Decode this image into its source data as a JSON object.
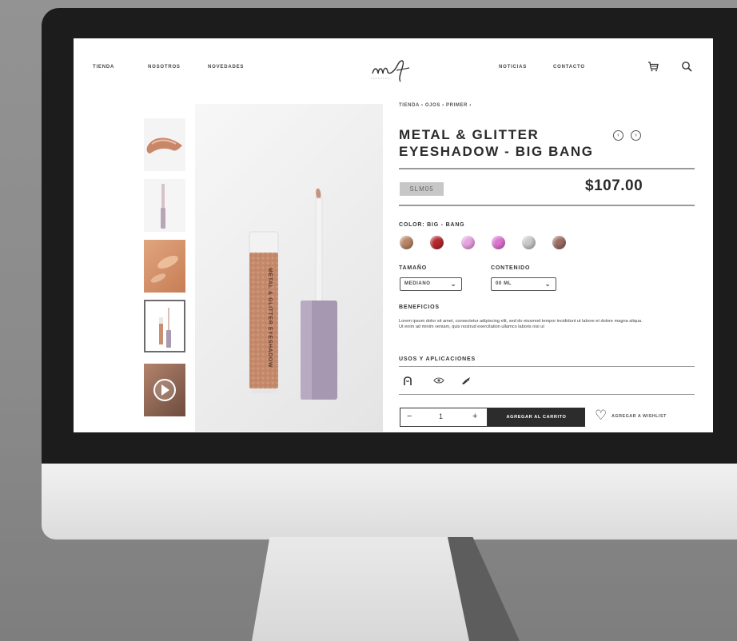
{
  "nav": {
    "left_items": [
      "TIENDA",
      "NOSOTROS",
      "NOVEDADES"
    ],
    "right_items": [
      "NOTICIAS",
      "CONTACTO"
    ],
    "logo_icon": "mf-logo",
    "cart_icon": "cart-icon",
    "search_icon": "search-icon"
  },
  "gallery": {
    "thumbnails": [
      {
        "icon": "swatch-smear-image"
      },
      {
        "icon": "tube-side-image"
      },
      {
        "icon": "skin-swatch-image"
      },
      {
        "icon": "product-tube-image",
        "active": true
      },
      {
        "icon": "play-video-icon"
      }
    ],
    "main_image_label": "METAL & GLITTER EYESHADOW"
  },
  "product": {
    "breadcrumb": "TIENDA › OJOS › PRIMER ›",
    "title_line1": "METAL & GLITTER",
    "title_line2": "EYESHADOW - BIG BANG",
    "sku": "SLM05",
    "price": "$107.00",
    "color_label": "COLOR: BIG - BANG",
    "colors": [
      "#b98566",
      "#b5282f",
      "#e9a3e0",
      "#dd74d0",
      "#c9c9c9",
      "#9b6c63"
    ],
    "size_label": "TAMAÑO",
    "size_value": "MEDIANO",
    "content_label": "CONTENIDO",
    "content_value": "00 ML",
    "benefits_label": "BENEFICIOS",
    "benefits_text": "Lorem ipsum dolor sit amet, consectetur adipiscing elit, sed do eiusmod tempor incididunt ut labore et dolore magna aliqua. Ut enim ad minim veniam, quis nostrud exercitation ullamco laboris nisi ut",
    "uses_label": "USOS Y APLICACIONES",
    "uses_icons": [
      "face-icon",
      "eye-icon",
      "brush-icon"
    ],
    "qty_minus": "−",
    "qty_value": "1",
    "qty_plus": "+",
    "add_to_cart": "AGREGAR AL CARRITO",
    "wishlist": "AGREGAR A WISHLIST"
  }
}
